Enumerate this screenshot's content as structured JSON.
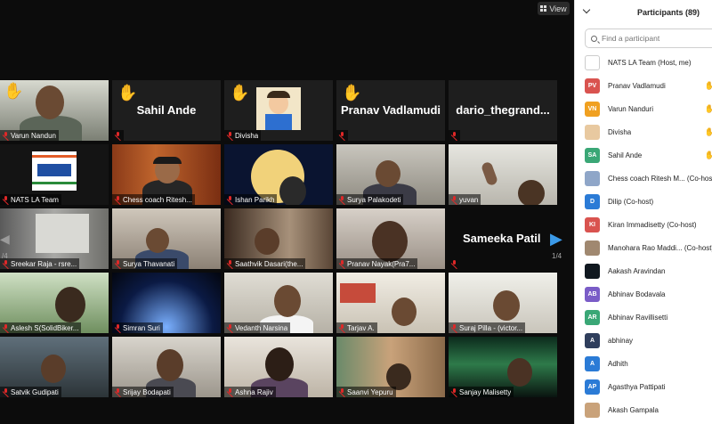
{
  "toolbar": {
    "view_label": "View"
  },
  "gallery": {
    "page_indicator_left": "/4",
    "page_indicator_right": "1/4",
    "tiles": [
      {
        "name": "Varun Nandun",
        "hand": true
      },
      {
        "name": "Sahil Ande",
        "hand": true,
        "name_only": true
      },
      {
        "name": "Divisha",
        "hand": true
      },
      {
        "name": "Pranav Vadlamudi",
        "hand": true,
        "name_only": true
      },
      {
        "name": "dario_thegrand...",
        "name_only": true
      },
      {
        "name": "NATS LA Team"
      },
      {
        "name": "Chess coach Ritesh..."
      },
      {
        "name": "Ishan Parikh"
      },
      {
        "name": "Surya Palakodeti"
      },
      {
        "name": "yuvan"
      },
      {
        "name": "Sreekar Raja - rsre..."
      },
      {
        "name": "Surya Thavanati"
      },
      {
        "name": "Saathvik Dasari(the..."
      },
      {
        "name": "Pranav Nayak(Pra7..."
      },
      {
        "name": "Sameeka Patil",
        "name_only": true
      },
      {
        "name": "Aslesh S(SolidBiker..."
      },
      {
        "name": "Simran Suri"
      },
      {
        "name": "Vedanth Narsina"
      },
      {
        "name": "Tarjav A."
      },
      {
        "name": "Suraj Pilla - (victor..."
      },
      {
        "name": "Satvik Gudipati"
      },
      {
        "name": "Srijay Bodapati"
      },
      {
        "name": "Ashna Rajiv"
      },
      {
        "name": "Saanvi Yepuru"
      },
      {
        "name": "Sanjay Malisetty"
      }
    ]
  },
  "participants_panel": {
    "title": "Participants (89)",
    "search_placeholder": "Find a participant",
    "list": [
      {
        "initials": "",
        "name": "NATS LA Team (Host, me)",
        "color": "#ffffff",
        "hand": false
      },
      {
        "initials": "PV",
        "name": "Pranav Vadlamudi",
        "color": "#d9534f",
        "hand": true
      },
      {
        "initials": "VN",
        "name": "Varun Nanduri",
        "color": "#f0a020",
        "hand": true
      },
      {
        "initials": "",
        "name": "Divisha",
        "color": "#e8c9a0",
        "hand": true
      },
      {
        "initials": "SA",
        "name": "Sahil Ande",
        "color": "#3aa776",
        "hand": true
      },
      {
        "initials": "",
        "name": "Chess coach Ritesh M... (Co-host)",
        "color": "#8fa6c8",
        "hand": false
      },
      {
        "initials": "D",
        "name": "Dilip (Co-host)",
        "color": "#2b7bd6",
        "hand": false
      },
      {
        "initials": "KI",
        "name": "Kiran Immadisetty (Co-host)",
        "color": "#d9534f",
        "hand": false
      },
      {
        "initials": "",
        "name": "Manohara Rao Maddi... (Co-host)",
        "color": "#a08870",
        "hand": false
      },
      {
        "initials": "",
        "name": "Aakash Aravindan",
        "color": "#101820",
        "hand": false
      },
      {
        "initials": "AB",
        "name": "Abhinav Bodavala",
        "color": "#7a5cc7",
        "hand": false
      },
      {
        "initials": "AR",
        "name": "Abhinav Ravillisetti",
        "color": "#3aa776",
        "hand": false
      },
      {
        "initials": "A",
        "name": "abhinay",
        "color": "#2f3e5c",
        "hand": false
      },
      {
        "initials": "A",
        "name": "Adhith",
        "color": "#2b7bd6",
        "hand": false
      },
      {
        "initials": "AP",
        "name": "Agasthya Pattipati",
        "color": "#2b7bd6",
        "hand": false
      },
      {
        "initials": "",
        "name": "Akash Gampala",
        "color": "#c9a27a",
        "hand": false
      }
    ]
  },
  "colors": {
    "active_speaker_border": "#c9e06b",
    "mic_muted": "#e02828",
    "nav_accent": "#3b9ae8"
  }
}
